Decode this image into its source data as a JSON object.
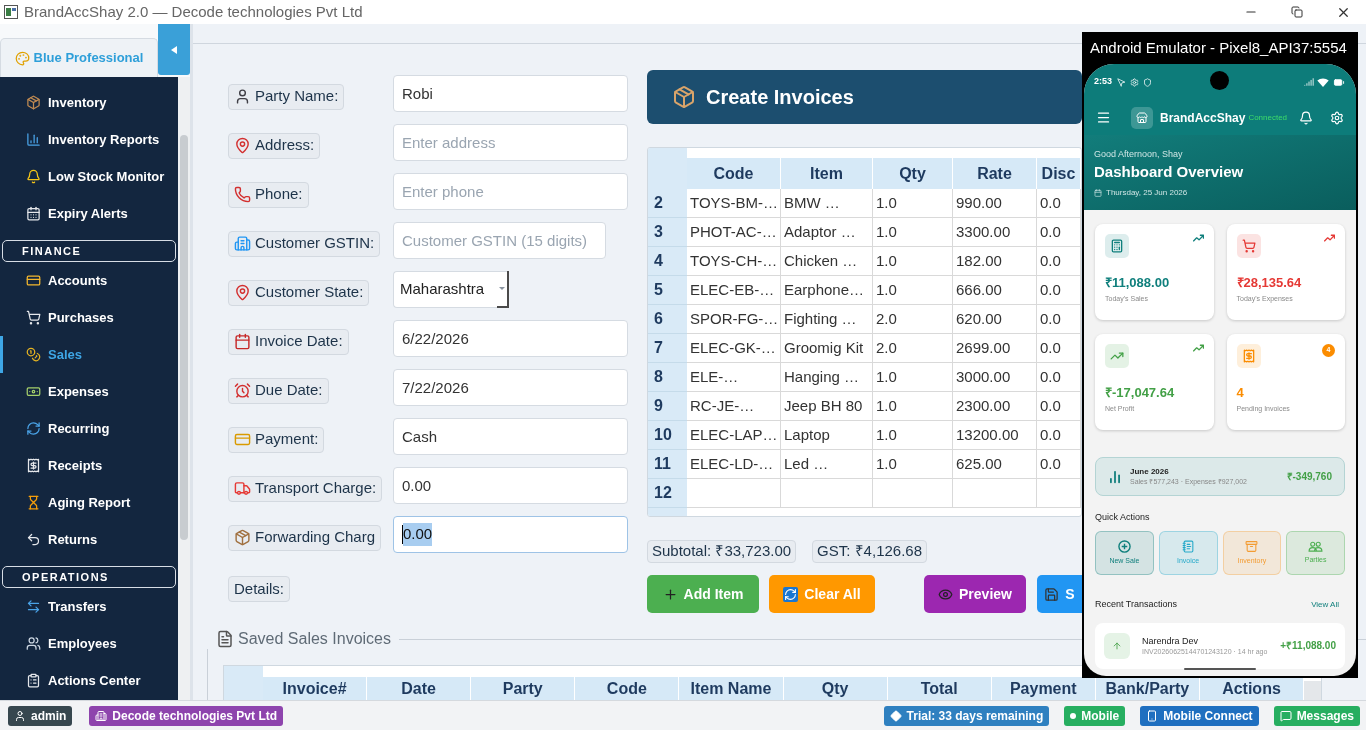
{
  "window": {
    "title": "BrandAccShay 2.0 — Decode technologies Pvt Ltd"
  },
  "sidebar": {
    "theme_button": "Blue Professional",
    "groups": [
      {
        "items": [
          {
            "label": "Inventory",
            "selected": false
          },
          {
            "label": "Inventory Reports",
            "selected": false
          },
          {
            "label": "Low Stock Monitor",
            "selected": false
          },
          {
            "label": "Expiry Alerts",
            "selected": false
          }
        ]
      },
      {
        "title": "FINANCE",
        "items": [
          {
            "label": "Accounts",
            "selected": false
          },
          {
            "label": "Purchases",
            "selected": false
          },
          {
            "label": "Sales",
            "selected": true
          },
          {
            "label": "Expenses",
            "selected": false
          },
          {
            "label": "Recurring",
            "selected": false
          },
          {
            "label": "Receipts",
            "selected": false
          },
          {
            "label": "Aging Report",
            "selected": false
          },
          {
            "label": "Returns",
            "selected": false
          }
        ]
      },
      {
        "title": "OPERATIONS",
        "items": [
          {
            "label": "Transfers",
            "selected": false
          },
          {
            "label": "Employees",
            "selected": false
          },
          {
            "label": "Actions Center",
            "selected": false
          }
        ]
      }
    ]
  },
  "customer_form": {
    "fields": [
      {
        "label": "Party Name:",
        "kind": "text",
        "value": "Robi",
        "focused": false
      },
      {
        "label": "Address:",
        "kind": "text",
        "placeholder": "Enter address",
        "focused": false
      },
      {
        "label": "Phone:",
        "kind": "text",
        "placeholder": "Enter phone",
        "focused": false
      },
      {
        "label": "Customer GSTIN:",
        "kind": "short",
        "placeholder": "Customer GSTIN (15 digits)",
        "focused": false
      },
      {
        "label": "Customer State:",
        "kind": "select",
        "value": "Maharashtra",
        "focused": false
      },
      {
        "label": "Invoice Date:",
        "kind": "text",
        "value": "6/22/2026",
        "focused": false
      },
      {
        "label": "Due Date:",
        "kind": "text",
        "value": "7/22/2026",
        "focused": false
      },
      {
        "label": "Payment:",
        "kind": "text",
        "value": "Cash",
        "focused": false
      },
      {
        "label": "Transport Charge:",
        "kind": "text",
        "value": "0.00",
        "focused": false
      },
      {
        "label": "Forwarding Charg",
        "kind": "text",
        "value": "0.00",
        "focused": true
      },
      {
        "label": "Details:",
        "kind": "label",
        "focused": false
      }
    ]
  },
  "invoice_panel": {
    "title": "Create Invoices",
    "table": {
      "columns": [
        "Code",
        "Item",
        "Qty",
        "Rate",
        "Disc"
      ],
      "rows": [
        {
          "number": "2",
          "cells": [
            "TOYS-BM-…",
            "BMW …",
            "1.0",
            "990.00",
            "0.0"
          ]
        },
        {
          "number": "3",
          "cells": [
            "PHOT-AC-…",
            "Adaptor …",
            "1.0",
            "3300.00",
            "0.0"
          ]
        },
        {
          "number": "4",
          "cells": [
            "TOYS-CH-…",
            "Chicken …",
            "1.0",
            "182.00",
            "0.0"
          ]
        },
        {
          "number": "5",
          "cells": [
            "ELEC-EB-…",
            "Earphone…",
            "1.0",
            "666.00",
            "0.0"
          ]
        },
        {
          "number": "6",
          "cells": [
            "SPOR-FG-…",
            "Fighting …",
            "2.0",
            "620.00",
            "0.0"
          ]
        },
        {
          "number": "7",
          "cells": [
            "ELEC-GK-…",
            "Groomig Kit",
            "2.0",
            "2699.00",
            "0.0"
          ]
        },
        {
          "number": "8",
          "cells": [
            "ELE-…",
            "Hanging …",
            "1.0",
            "3000.00",
            "0.0"
          ]
        },
        {
          "number": "9",
          "cells": [
            "RC-JE-…",
            "Jeep BH 80",
            "1.0",
            "2300.00",
            "0.0"
          ]
        },
        {
          "number": "10",
          "cells": [
            "ELEC-LAP…",
            "Laptop",
            "1.0",
            "13200.00",
            "0.0"
          ]
        },
        {
          "number": "11",
          "cells": [
            "ELEC-LD-…",
            "Led …",
            "1.0",
            "625.00",
            "0.0"
          ]
        },
        {
          "number": "12"
        }
      ]
    },
    "totals": [
      "Subtotal: ₹33,723.00",
      "GST: ₹4,126.68"
    ],
    "item_buttons": [
      {
        "label": "Add Item",
        "color": "#4caf50"
      },
      {
        "label": "Clear All",
        "color": "#ff9800"
      }
    ],
    "document_buttons": [
      {
        "label": "Preview",
        "color": "#9c27b0"
      },
      {
        "label": "S",
        "color": "#2196f3"
      }
    ]
  },
  "saved_invoices": {
    "title": "Saved Sales Invoices",
    "columns": [
      "Invoice#",
      "Date",
      "Party",
      "Code",
      "Item Name",
      "Qty",
      "Total",
      "Payment",
      "Bank/Party",
      "Actions"
    ]
  },
  "status_bar": {
    "left": [
      {
        "label": "admin",
        "color": "#37474f"
      },
      {
        "label": "Decode technologies Pvt Ltd",
        "color": "#8e44ad"
      }
    ],
    "right": [
      {
        "label": "Trial: 33 days remaining",
        "color": "#2f80c0"
      },
      {
        "label": "Mobile",
        "color": "#27ae60"
      },
      {
        "label": "Mobile Connect",
        "color": "#1f6fc0"
      },
      {
        "label": "Messages",
        "color": "#27ae60"
      }
    ]
  },
  "emulator": {
    "title": "Android Emulator - Pixel8_API37:5554",
    "phone": {
      "time": "2:53",
      "app_name": "BrandAccShay",
      "connection": "Connected",
      "greeting": "Good Afternoon, Shay",
      "heading": "Dashboard Overview",
      "date": "Thursday, 25 Jun 2026",
      "stats": [
        {
          "value": "₹11,088.00",
          "label": "Today's Sales",
          "color": "#0f7f7c"
        },
        {
          "value": "₹28,135.64",
          "label": "Today's Expenses",
          "color": "#e53935"
        },
        {
          "value": "₹-17,047.64",
          "label": "Net Profit",
          "color": "#43a047"
        },
        {
          "value": "4",
          "label": "Pending Invoices",
          "color": "#fb8c00"
        }
      ],
      "pending_badge": "4",
      "month_summary": {
        "title": "June 2026",
        "details": "Sales ₹577,243 · Expenses ₹927,002",
        "net": "₹-349,760"
      },
      "quick_actions_title": "Quick Actions",
      "quick_actions": [
        {
          "label": "New Sale",
          "color": "#0f7f7c"
        },
        {
          "label": "Invoice",
          "color": "#26a9c9"
        },
        {
          "label": "Inventory",
          "color": "#f39c33"
        },
        {
          "label": "Parties",
          "color": "#4caf50"
        }
      ],
      "recent_title": "Recent Transactions",
      "view_all": "View All",
      "transactions": [
        {
          "name": "Narendra Dev",
          "details": "INV20260625144701243120 · 14 hr ago",
          "amount": "+₹11,088.00"
        }
      ]
    }
  }
}
